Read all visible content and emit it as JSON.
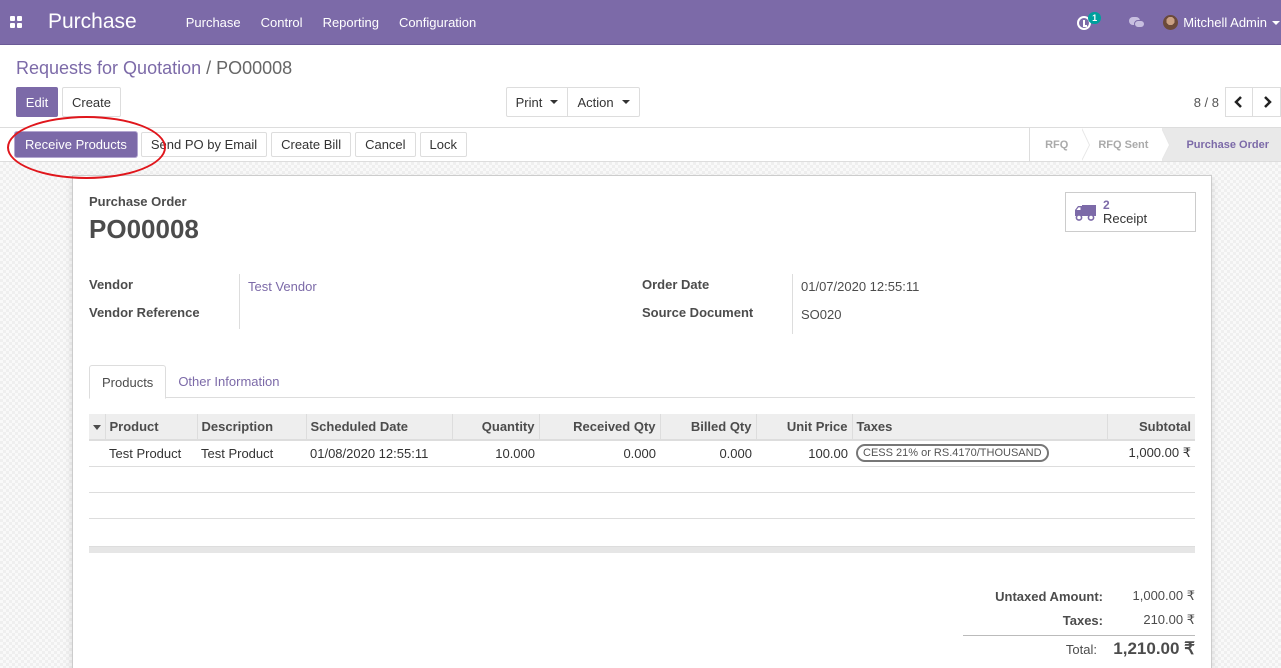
{
  "navbar": {
    "app_name": "Purchase",
    "menu": [
      "Purchase",
      "Control",
      "Reporting",
      "Configuration"
    ],
    "activity_count": "1",
    "user_name": "Mitchell Admin",
    "accent_color": "#7c6aa8"
  },
  "control_panel": {
    "breadcrumb_parent": "Requests for Quotation",
    "breadcrumb_separator": "/",
    "breadcrumb_current": "PO00008",
    "edit_label": "Edit",
    "create_label": "Create",
    "print_label": "Print",
    "action_label": "Action",
    "pager_value": "8 / 8",
    "pager_prev": "‹",
    "pager_next": "›"
  },
  "header": {
    "buttons": [
      "Receive Products",
      "Send PO by Email",
      "Create Bill",
      "Cancel",
      "Lock"
    ],
    "stages": [
      "RFQ",
      "RFQ Sent",
      "Purchase Order"
    ],
    "active_stage": "Purchase Order"
  },
  "sheet": {
    "smart_button": {
      "value": "2",
      "label": "Receipt",
      "icon": "truck-icon"
    },
    "doc_label": "Purchase Order",
    "doc_name": "PO00008",
    "fields": {
      "vendor_label": "Vendor",
      "vendor_value": "Test Vendor",
      "vendor_ref_label": "Vendor Reference",
      "vendor_ref_value": "",
      "order_date_label": "Order Date",
      "order_date_value": "01/07/2020 12:55:11",
      "source_doc_label": "Source Document",
      "source_doc_value": "SO020"
    },
    "tabs": [
      "Products",
      "Other Information"
    ],
    "active_tab": "Products",
    "table": {
      "columns": [
        "Product",
        "Description",
        "Scheduled Date",
        "Quantity",
        "Received Qty",
        "Billed Qty",
        "Unit Price",
        "Taxes",
        "Subtotal"
      ],
      "rows": [
        {
          "product": "Test Product",
          "description": "Test Product",
          "scheduled_date": "01/08/2020 12:55:11",
          "quantity": "10.000",
          "received_qty": "0.000",
          "billed_qty": "0.000",
          "unit_price": "100.00",
          "taxes": "CESS 21% or RS.4170/THOUSAND",
          "subtotal": "1,000.00 ₹"
        }
      ]
    },
    "totals": {
      "untaxed_label": "Untaxed Amount:",
      "untaxed_value": "1,000.00 ₹",
      "taxes_label": "Taxes:",
      "taxes_value": "210.00 ₹",
      "total_label": "Total:",
      "total_value": "1,210.00 ₹"
    }
  }
}
